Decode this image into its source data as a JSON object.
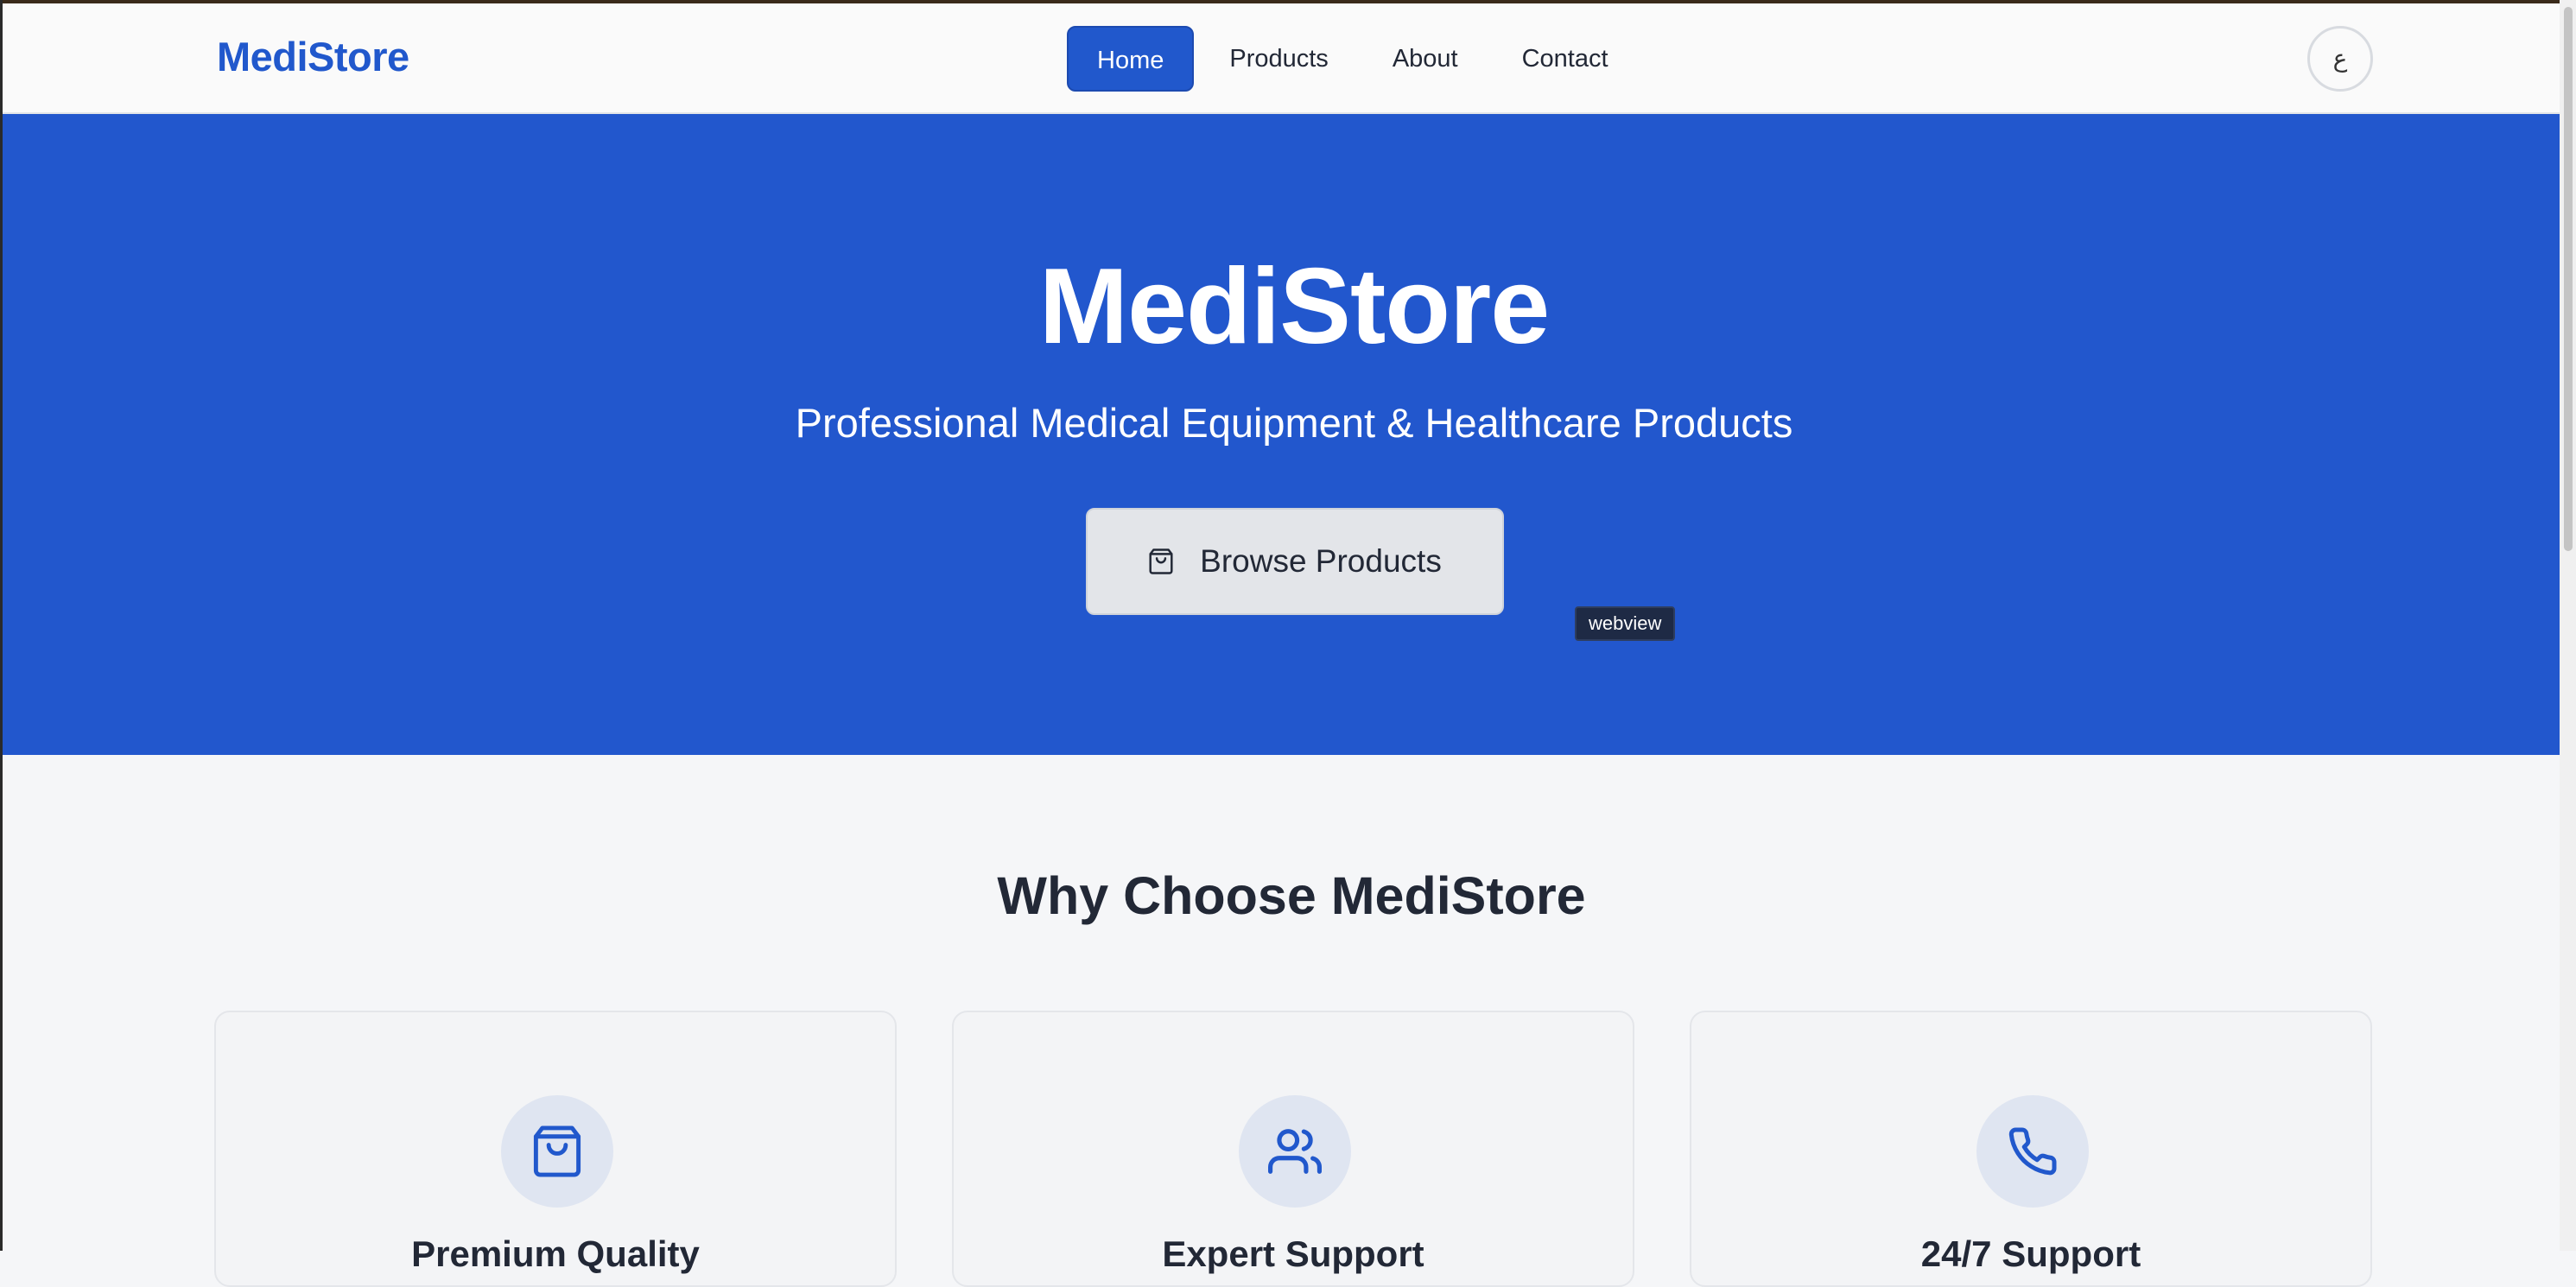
{
  "navbar": {
    "logo": "MediStore",
    "links": [
      {
        "label": "Home",
        "active": true
      },
      {
        "label": "Products"
      },
      {
        "label": "About"
      },
      {
        "label": "Contact"
      }
    ],
    "language_toggle": "ع"
  },
  "hero": {
    "title": "MediStore",
    "subtitle": "Professional Medical Equipment & Healthcare Products",
    "cta_label": "Browse Products",
    "cta_icon": "shopping-bag-icon",
    "tooltip": "webview"
  },
  "features": {
    "title": "Why Choose MediStore",
    "cards": [
      {
        "icon": "shopping-bag-icon",
        "title": "Premium Quality"
      },
      {
        "icon": "users-icon",
        "title": "Expert Support"
      },
      {
        "icon": "phone-icon",
        "title": "24/7 Support"
      }
    ]
  },
  "colors": {
    "primary": "#2158cc",
    "hero_bg": "#2257cd",
    "text_dark": "#222836",
    "page_bg": "#f5f6f8"
  }
}
